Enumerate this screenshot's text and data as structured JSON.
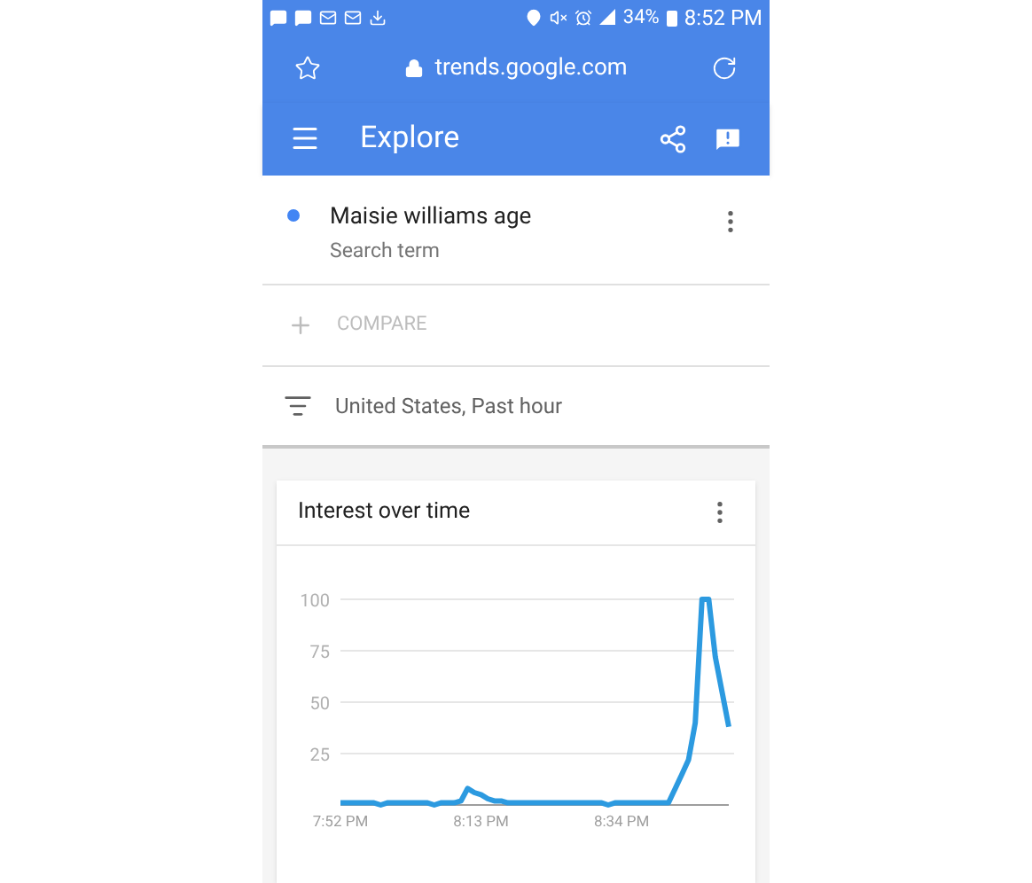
{
  "status_bar": {
    "battery": "34%",
    "time": "8:52 PM"
  },
  "address_bar": {
    "url": "trends.google.com"
  },
  "toolbar": {
    "title": "Explore"
  },
  "search_terms": [
    {
      "term": "Maisie williams age",
      "subtitle": "Search term",
      "color": "#4285f4"
    }
  ],
  "compare": {
    "label": "COMPARE"
  },
  "filter": {
    "label": "United States, Past hour"
  },
  "card": {
    "title": "Interest over time",
    "chart_data": {
      "type": "line",
      "categories": [
        "7:52 PM",
        null,
        null,
        null,
        null,
        null,
        null,
        null,
        null,
        null,
        null,
        null,
        null,
        null,
        null,
        null,
        null,
        null,
        null,
        null,
        null,
        "8:13 PM",
        null,
        null,
        null,
        null,
        null,
        null,
        null,
        null,
        null,
        null,
        null,
        null,
        null,
        null,
        null,
        null,
        null,
        null,
        null,
        null,
        "8:34 PM",
        null,
        null,
        null,
        null,
        null,
        null,
        null,
        null,
        null,
        null,
        null,
        null,
        null,
        null,
        null,
        null
      ],
      "series": [
        {
          "color": "#2c9ae0",
          "values": [
            1,
            1,
            1,
            1,
            1,
            1,
            0,
            1,
            1,
            1,
            1,
            1,
            1,
            1,
            0,
            1,
            1,
            1,
            2,
            8,
            6,
            5,
            3,
            2,
            2,
            1,
            1,
            1,
            1,
            1,
            1,
            1,
            1,
            1,
            1,
            1,
            1,
            1,
            1,
            1,
            0,
            1,
            1,
            1,
            1,
            1,
            1,
            1,
            1,
            1,
            8,
            15,
            22,
            40,
            100,
            100,
            72,
            55,
            38
          ]
        }
      ],
      "ylim": [
        0,
        100
      ],
      "yticks": [
        25,
        50,
        75,
        100
      ],
      "grid": true
    }
  }
}
